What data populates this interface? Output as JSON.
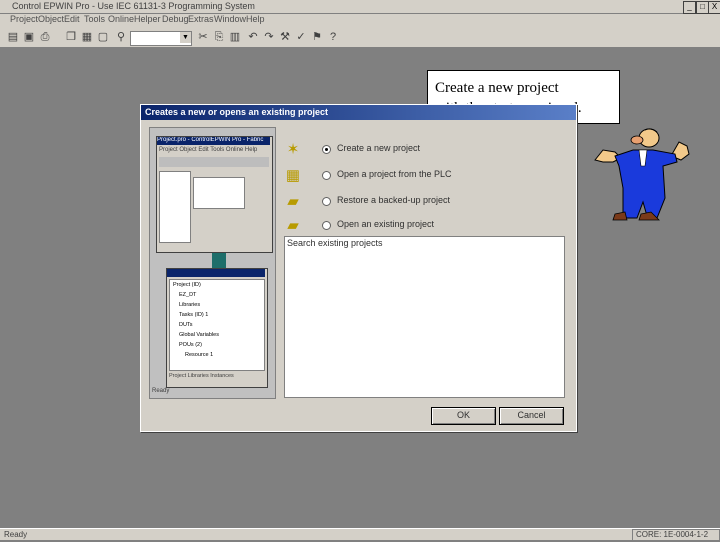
{
  "window": {
    "title": "Control EPWIN Pro - Use IEC 61131-3 Programming System",
    "controls": [
      "_",
      "□",
      "X"
    ]
  },
  "menu": [
    "Project",
    "Object",
    "Edit",
    "Tools",
    "Online",
    "Helper",
    "Debug",
    "Extras",
    "Window",
    "Help"
  ],
  "toolbar": {
    "icons": [
      "open-icon",
      "save-icon",
      "print-icon",
      "copy-icon",
      "paste-icon",
      "find-icon",
      "cut-icon",
      "undo-icon",
      "redo-icon",
      "build-icon",
      "check-icon"
    ]
  },
  "callout": {
    "text_line1": "Create a new project",
    "text_line2": "with the start-up wizard."
  },
  "dialog": {
    "title": "Creates a new or opens an existing project",
    "preview": {
      "window_title": "Project.pro - ControlEPWIN Pro - Fabric",
      "menu": "Project  Object  Edit  Tools  Online  Help",
      "tree_items": [
        "Project (ID)",
        "EZ_DT",
        "Libraries",
        "Tasks (ID) 1",
        "DUTs",
        "Global Variables",
        "POUs (2)",
        "Resource 1"
      ],
      "tabs": "Project  Libraries  Instances",
      "status": "Ready"
    },
    "options": [
      {
        "label": "Create a new project",
        "selected": true
      },
      {
        "label": "Open a project from the PLC",
        "selected": false
      },
      {
        "label": "Restore a backed-up project",
        "selected": false
      },
      {
        "label": "Open an existing project",
        "selected": false
      }
    ],
    "recent_label": "Search existing projects",
    "ok_label": "OK",
    "cancel_label": "Cancel"
  },
  "status": {
    "left": "Ready",
    "right": "CORE: 1E-0004-1-2"
  }
}
